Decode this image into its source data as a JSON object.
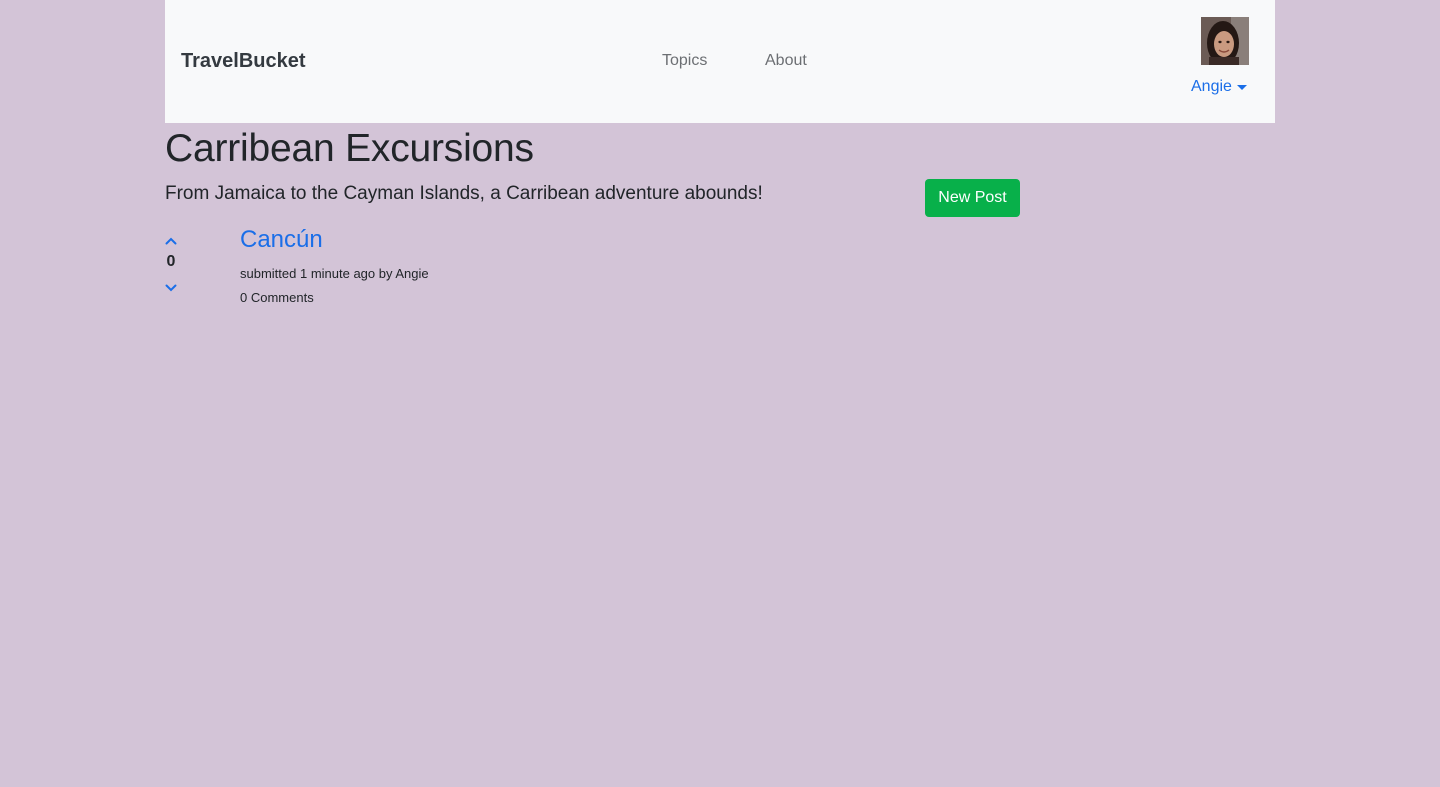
{
  "navbar": {
    "brand": "TravelBucket",
    "links": [
      {
        "label": "Topics"
      },
      {
        "label": "About"
      }
    ],
    "user": {
      "name": "Angie",
      "avatar_icon": "user-avatar-photo"
    }
  },
  "topic": {
    "title": "Carribean Excursions",
    "description": "From Jamaica to the Cayman Islands, a Carribean adventure abounds!",
    "new_post_label": "New Post"
  },
  "posts": [
    {
      "title": "Cancún",
      "votes": "0",
      "meta": "submitted 1 minute ago by Angie",
      "comments": "0 Comments"
    }
  ],
  "colors": {
    "background": "#d3c4d7",
    "navbar": "#f8f9fa",
    "link": "#1a6ee8",
    "button": "#08b04a"
  }
}
